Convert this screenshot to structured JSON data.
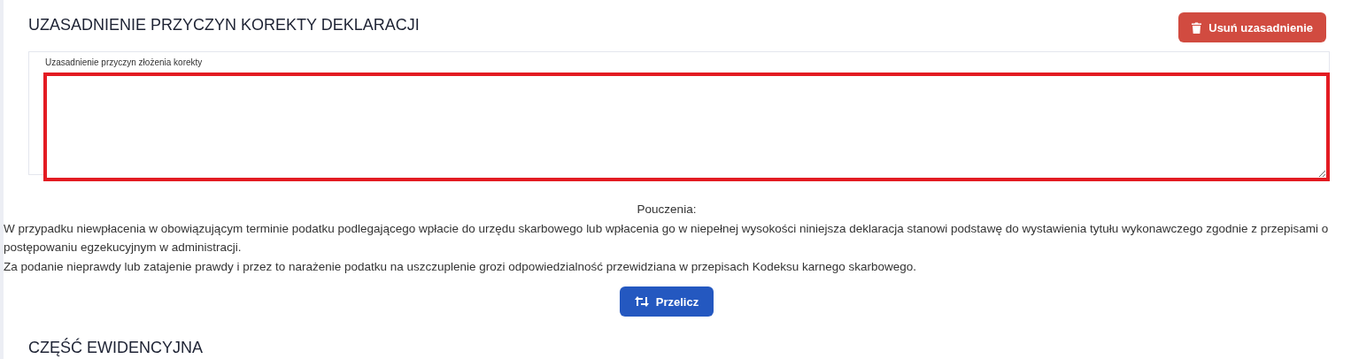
{
  "section_title": "UZASADNIENIE PRZYCZYN KOREKTY DEKLARACJI",
  "delete_button": {
    "label": "Usuń uzasadnienie"
  },
  "justification_field": {
    "label": "Uzasadnienie przyczyn złożenia korekty",
    "invalid": true
  },
  "instructions": {
    "heading": "Pouczenia:",
    "paragraphs": [
      "W przypadku niewpłacenia w obowiązującym terminie podatku podlegającego wpłacie do urzędu skarbowego lub wpłacenia go w niepełnej wysokości niniejsza deklaracja stanowi podstawę do wystawienia tytułu wykonawczego zgodnie z przepisami o postępowaniu egzekucyjnym w administracji.",
      "Za podanie nieprawdy lub zatajenie prawdy i przez to narażenie podatku na uszczuplenie grozi odpowiedzialność przewidziana w przepisach Kodeksu karnego skarbowego."
    ]
  },
  "recalculate_button": {
    "label": "Przelicz"
  },
  "next_section_title": "CZĘŚĆ EWIDENCYJNA"
}
